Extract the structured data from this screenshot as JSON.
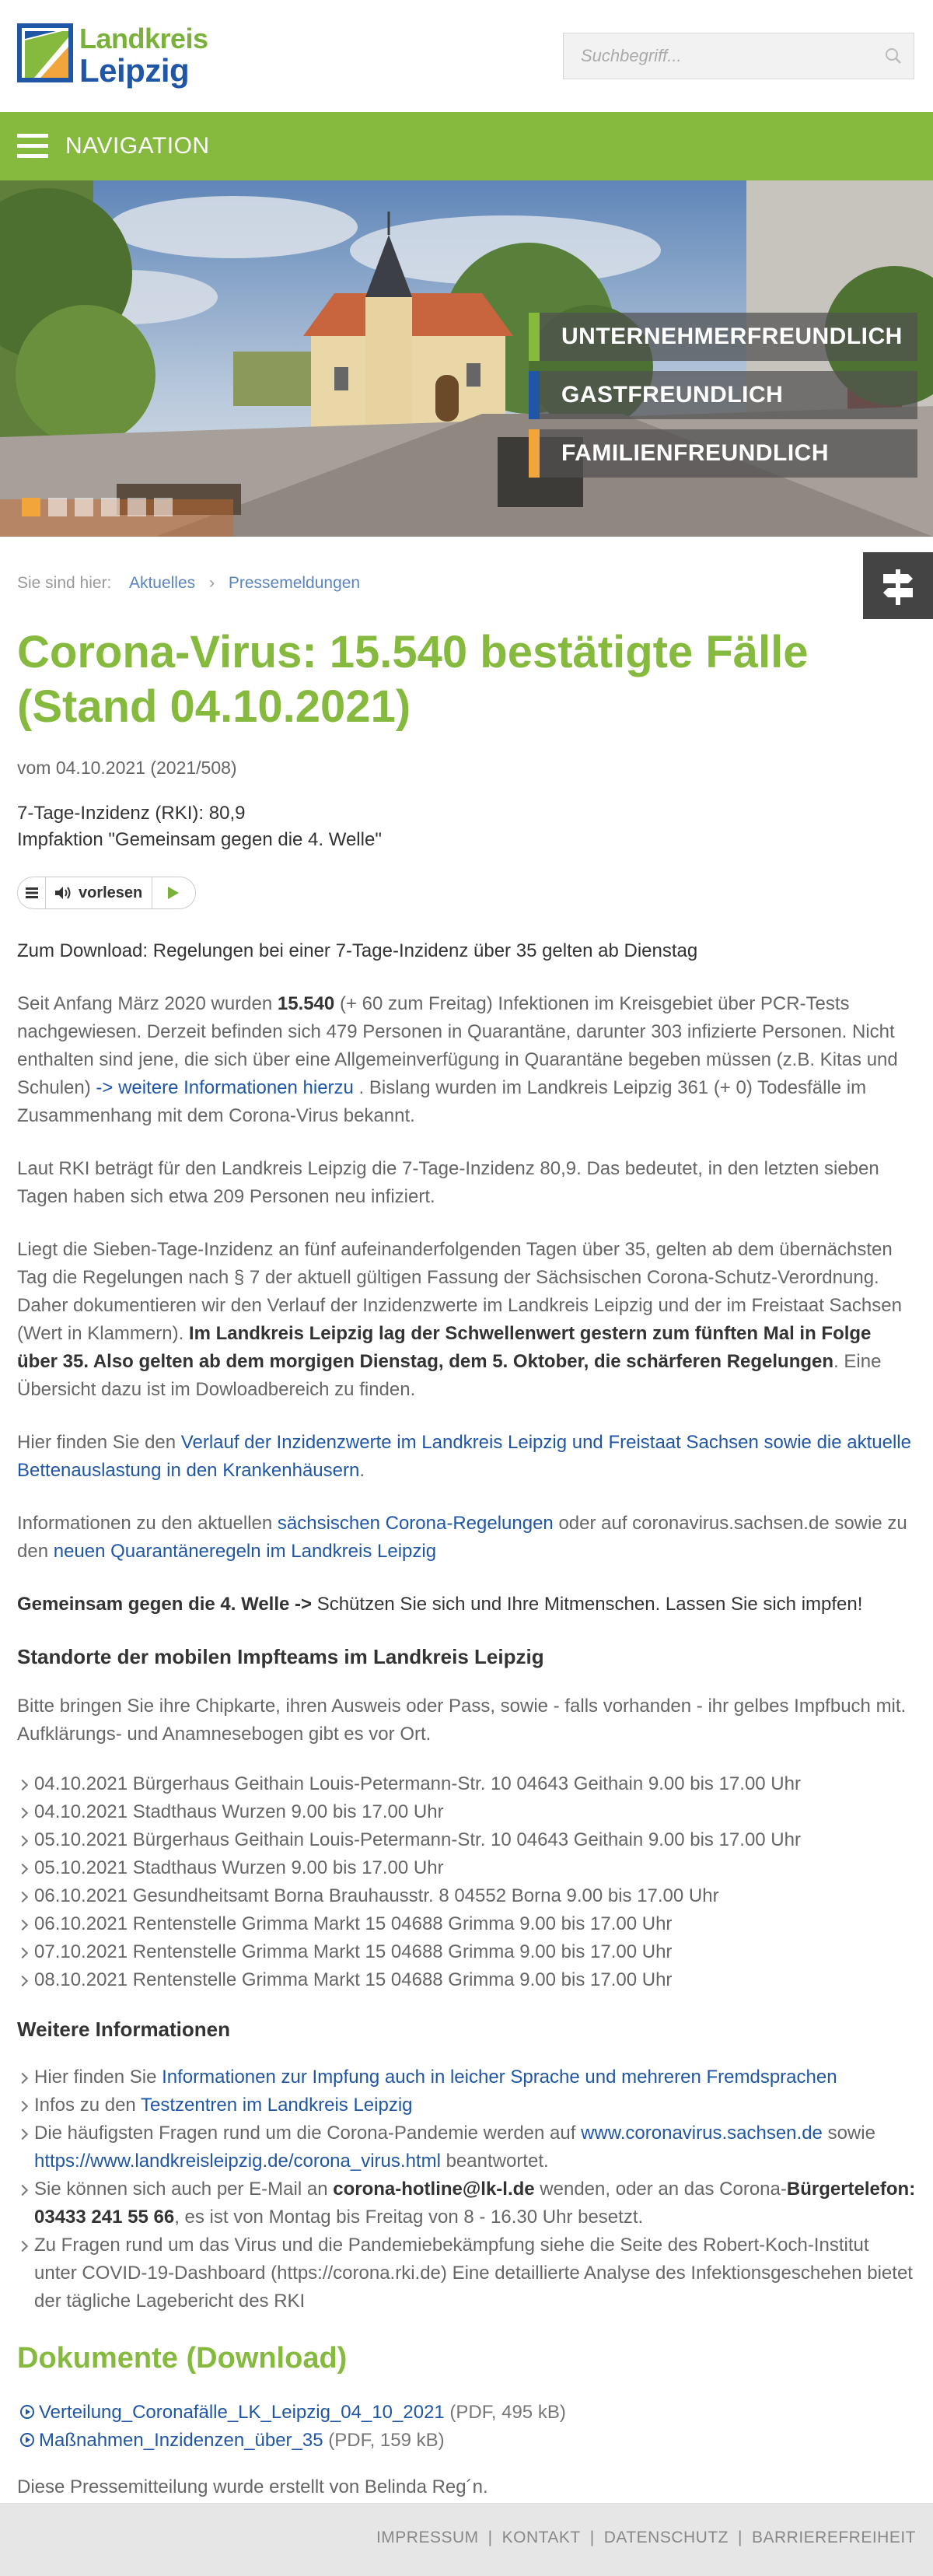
{
  "header": {
    "logo_line1": "Landkreis",
    "logo_line2": "Leipzig",
    "search_placeholder": "Suchbegriff...",
    "search_icon": "search-icon"
  },
  "nav": {
    "label": "NAVIGATION",
    "icon": "hamburger-icon"
  },
  "hero": {
    "slogans": [
      {
        "text": "UNTERNEHMERFREUNDLICH",
        "color": "#86ba3f"
      },
      {
        "text": "GASTFREUNDLICH",
        "color": "#1f56a6"
      },
      {
        "text": "FAMILIENFREUNDLICH",
        "color": "#f2a53a"
      }
    ],
    "active_slide": 1,
    "slide_count": 6
  },
  "side_tab": {
    "icon": "signpost-icon"
  },
  "breadcrumb": {
    "prefix": "Sie sind hier:",
    "items": [
      "Aktuelles",
      "Pressemeldungen"
    ]
  },
  "article": {
    "title": "Corona-Virus: 15.540 bestätigte Fälle (Stand 04.10.2021)",
    "date": "vom 04.10.2021 (2021/508)",
    "lead_line1": "7-Tage-Inzidenz (RKI): 80,9",
    "lead_line2": "Impfaktion \"Gemeinsam gegen die 4. Welle\"",
    "readspeaker": {
      "label": "vorlesen"
    },
    "download_note": "Zum Download: Regelungen bei einer 7-Tage-Inzidenz über 35 gelten ab Dienstag",
    "p1_a": "Seit Anfang März 2020 wurden ",
    "p1_bold": "15.540",
    "p1_b": " (+ 60 zum Freitag) Infektionen im Kreisgebiet über PCR-Tests nachgewiesen. Derzeit befinden sich 479 Personen in Quarantäne, darunter 303 infizierte Personen. Nicht enthalten sind jene, die sich über eine Allgemeinverfügung in Quarantäne begeben müssen (z.B. Kitas und Schulen) ",
    "p1_link": "-> weitere Informationen hierzu",
    "p1_c": " . Bislang wurden im Landkreis Leipzig 361 (+ 0) Todesfälle im Zusammenhang mit dem Corona-Virus bekannt.",
    "p2": "Laut RKI beträgt für den Landkreis Leipzig die 7-Tage-Inzidenz 80,9. Das bedeutet, in den letzten sieben Tagen haben sich etwa 209 Personen neu infiziert.",
    "p3_a": "Liegt die Sieben-Tage-Inzidenz an fünf aufeinanderfolgenden Tagen über 35, gelten ab dem übernächsten Tag die Regelungen nach § 7 der aktuell gültigen Fassung der Sächsischen Corona-Schutz-Verordnung. Daher dokumentieren wir den Verlauf der Inzidenzwerte im Landkreis Leipzig und der im Freistaat Sachsen (Wert in Klammern). ",
    "p3_bold": "Im Landkreis Leipzig lag der Schwellenwert gestern zum fünften Mal in Folge über 35. Also gelten ab dem morgigen Dienstag, dem 5. Oktober, die schärferen Regelungen",
    "p3_c": ". Eine Übersicht dazu ist im Dowloadbereich zu finden.",
    "p4_a": "Hier finden Sie den ",
    "p4_link": "Verlauf der Inzidenzwerte im Landkreis Leipzig und Freistaat Sachsen sowie die aktuelle Bettenauslastung in den Krankenhäusern",
    "p4_b": ".",
    "p5_a": "Informationen zu den aktuellen ",
    "p5_link1": "sächsischen Corona-Regelungen",
    "p5_b": " oder auf coronavirus.sachsen.de sowie zu den ",
    "p5_link2": "neuen Quarantäneregeln im Landkreis Leipzig",
    "p6_bold": "Gemeinsam gegen die 4. Welle ->",
    "p6_rest": " Schützen Sie sich und Ihre Mitmenschen. Lassen Sie sich impfen!",
    "h_impf": "Standorte der mobilen Impfteams im Landkreis Leipzig",
    "p7": "Bitte bringen Sie ihre Chipkarte, ihren Ausweis oder Pass, sowie - falls vorhanden - ihr gelbes Impfbuch mit. Aufklärungs- und Anamnesebogen gibt es vor Ort.",
    "impf_list": [
      "04.10.2021 Bürgerhaus Geithain Louis-Petermann-Str. 10 04643 Geithain 9.00 bis 17.00 Uhr",
      "04.10.2021 Stadthaus Wurzen 9.00 bis 17.00 Uhr",
      "05.10.2021 Bürgerhaus Geithain Louis-Petermann-Str. 10 04643 Geithain 9.00 bis 17.00 Uhr",
      "05.10.2021 Stadthaus Wurzen 9.00 bis 17.00 Uhr",
      "06.10.2021 Gesundheitsamt Borna Brauhausstr. 8 04552 Borna 9.00 bis 17.00 Uhr",
      "06.10.2021 Rentenstelle Grimma Markt 15 04688 Grimma 9.00 bis 17.00 Uhr",
      "07.10.2021 Rentenstelle Grimma Markt 15 04688 Grimma 9.00 bis 17.00 Uhr",
      "08.10.2021 Rentenstelle Grimma Markt 15 04688 Grimma 9.00 bis 17.00 Uhr"
    ],
    "h_more": "Weitere Informationen",
    "more": {
      "i1_a": "Hier finden Sie ",
      "i1_link": "Informationen zur Impfung auch in leicher Sprache und mehreren Fremdsprachen",
      "i2_a": "Infos zu den ",
      "i2_link": "Testzentren im Landkreis Leipzig",
      "i3_a": "Die häufigsten Fragen rund um die Corona-Pandemie werden auf ",
      "i3_link1": "www.coronavirus.sachsen.de",
      "i3_b": "  sowie ",
      "i3_link2": "https://www.landkreisleipzig.de/corona_virus.html",
      "i3_c": " beantwortet.",
      "i4_a": "Sie können sich auch per E-Mail an ",
      "i4_bold1": "corona-hotline@lk-l.de",
      "i4_b": " wenden, oder an das Corona-",
      "i4_bold2": "Bürgertelefon: 03433 241 55 66",
      "i4_c": ", es ist von Montag bis Freitag von 8 - 16.30 Uhr besetzt.",
      "i5": "Zu Fragen rund um das Virus und die Pandemiebekämpfung siehe die Seite des Robert-Koch-Institut unter COVID-19-Dashboard (https://corona.rki.de)  Eine detaillierte Analyse des Infektionsgeschehen bietet der tägliche Lagebericht des RKI"
    },
    "h_docs": "Dokumente (Download)",
    "docs": [
      {
        "name": "Verteilung_Coronafälle_LK_Leipzig_04_10_2021",
        "meta": " (PDF, 495 kB)"
      },
      {
        "name": "Maßnahmen_Inzidenzen_über_35",
        "meta": " (PDF, 159 kB)"
      }
    ],
    "author": "Diese Pressemitteilung wurde erstellt von Belinda Reg´n."
  },
  "footer": {
    "links": [
      "IMPRESSUM",
      "KONTAKT",
      "DATENSCHUTZ",
      "BARRIEREFREIHEIT"
    ]
  },
  "colors": {
    "green": "#86ba3f",
    "blue": "#1f56a6",
    "orange": "#f2a53a",
    "footer_bg": "#e6e6e6"
  }
}
